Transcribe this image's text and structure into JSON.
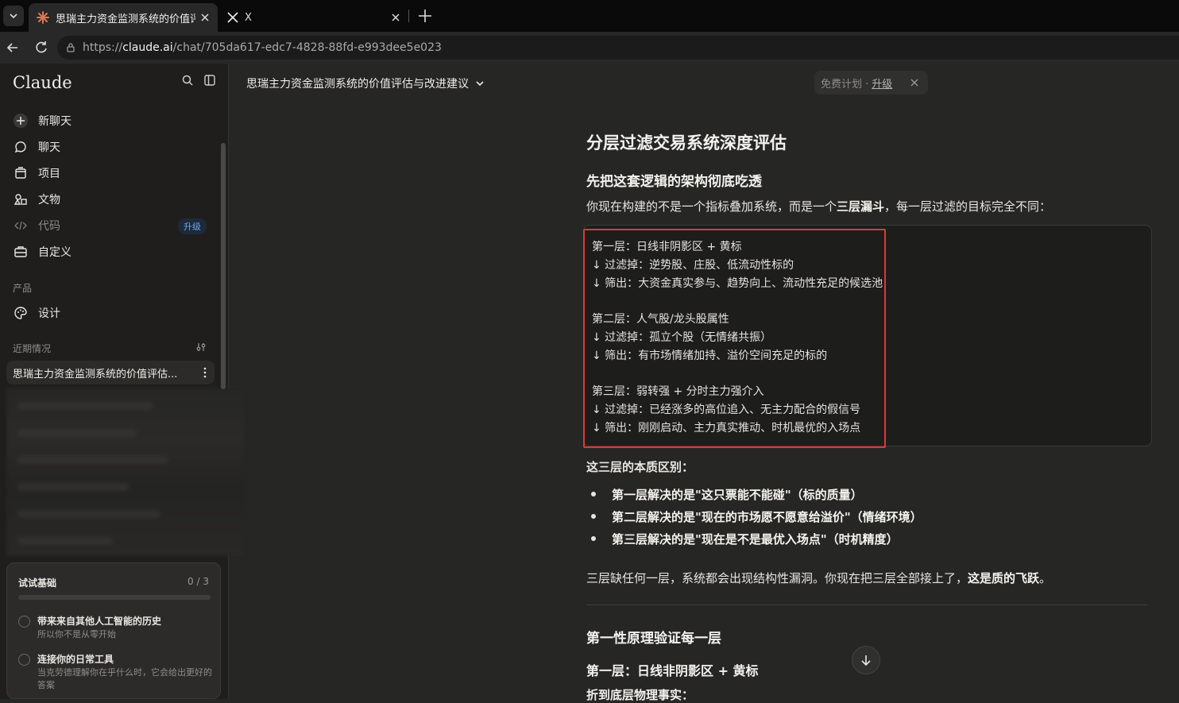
{
  "browser": {
    "active_tab_title": "思瑞主力资金监测系统的价值评估",
    "inactive_tab_title": "X",
    "url_prefix": "https://",
    "url_host": "claude.ai",
    "url_path": "/chat/705da617-edc7-4828-88fd-e993dee5e023"
  },
  "sidebar": {
    "logo": "Claude",
    "nav": [
      {
        "label": "新聊天",
        "icon": "plus-icon"
      },
      {
        "label": "聊天",
        "icon": "chat-icon"
      },
      {
        "label": "项目",
        "icon": "folder-icon"
      },
      {
        "label": "文物",
        "icon": "artifacts-icon"
      },
      {
        "label": "代码",
        "icon": "code-icon",
        "badge": "升级"
      },
      {
        "label": "自定义",
        "icon": "briefcase-icon"
      }
    ],
    "products_label": "产品",
    "design_label": "设计",
    "recent_label": "近期情况",
    "recent_item": "思瑞主力资金监测系统的价值评估...",
    "starter_card": {
      "title": "试试基础",
      "count": "0 / 3",
      "progress": 0,
      "tasks": [
        {
          "title": "带来来自其他人工智能的历史",
          "sub": "所以你不是从零开始"
        },
        {
          "title": "连接你的日常工具",
          "sub": "当克劳德理解你在乎什么时，它会给出更好的答案"
        }
      ]
    }
  },
  "header": {
    "chat_title": "思瑞主力资金监测系统的价值评估与改进建议",
    "plan_text": "免费计划 ·",
    "upgrade_text": "升级"
  },
  "article": {
    "h1": "分层过滤交易系统深度评估",
    "h2_arch": "先把这套逻辑的架构彻底吃透",
    "intro_a": "你现在构建的不是一个指标叠加系统，而是一个",
    "intro_b": "三层漏斗",
    "intro_c": "，每一层过滤的目标完全不同：",
    "code_lines": [
      "第一层：日线非阴影区 + 黄标",
      "↓ 过滤掉：逆势股、庄股、低流动性标的",
      "↓ 筛出：大资金真实参与、趋势向上、流动性充足的候选池",
      "第二层：人气股/龙头股属性",
      "↓ 过滤掉：孤立个股（无情绪共振）",
      "↓ 筛出：有市场情绪加持、溢价空间充足的标的",
      "第三层：弱转强 + 分时主力强介入",
      "↓ 过滤掉：已经涨多的高位追入、无主力配合的假信号",
      "↓ 筛出：刚刚启动、主力真实推动、时机最优的入场点"
    ],
    "diff_title": "这三层的本质区别：",
    "bullets": [
      {
        "a": "第一层解决的是\"这只票能不能碰\"",
        "b": "（标的质量）"
      },
      {
        "a": "第二层解决的是\"现在的市场愿不愿意给溢价\"",
        "b": "（情绪环境）"
      },
      {
        "a": "第三层解决的是\"现在是不是最优入场点\"",
        "b": "（时机精度）"
      }
    ],
    "summary_a": "三层缺任何一层，系统都会出现结构性漏洞。你现在把三层全部接上了，",
    "summary_b": "这是质的飞跃",
    "summary_c": "。",
    "h2_first": "第一性原理验证每一层",
    "h3_layer1": "第一层：日线非阴影区 + 黄标",
    "cut_text": "折到底层物理事实："
  }
}
